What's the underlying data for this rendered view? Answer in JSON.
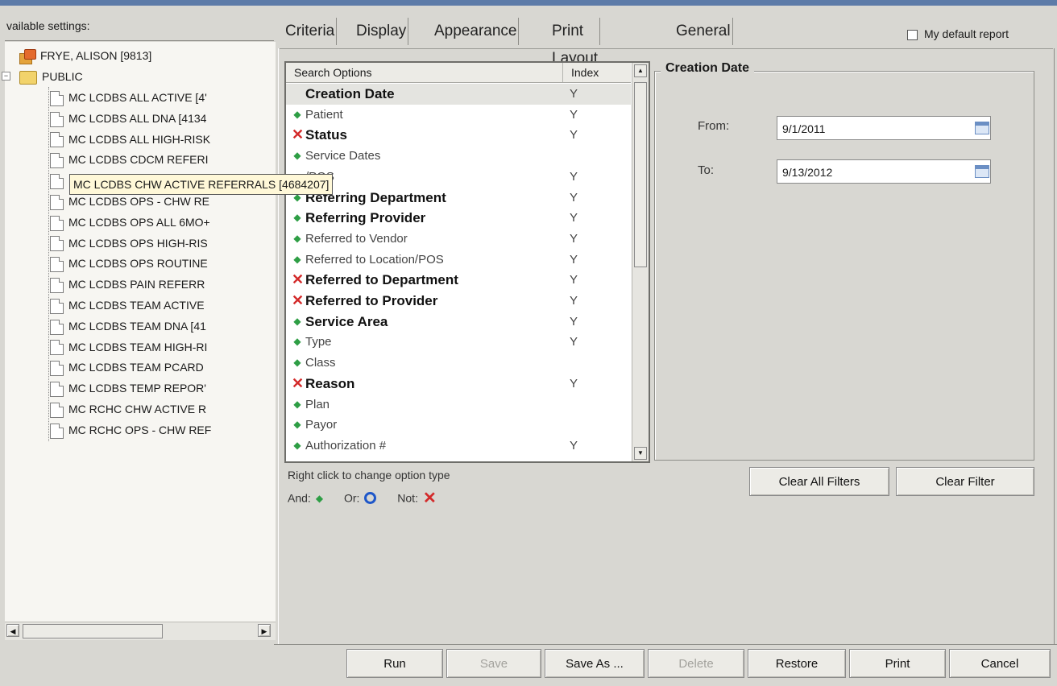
{
  "left_panel": {
    "available_label": "vailable settings:",
    "tree": {
      "user_node": "FRYE, ALISON [9813]",
      "public_node": "PUBLIC",
      "items": [
        "MC LCDBS ALL ACTIVE [4'",
        "MC LCDBS ALL DNA [4134",
        "MC LCDBS ALL HIGH-RISK",
        "MC LCDBS CDCM REFERI",
        "MC LCDBS CHW ACTIVE REFERRALS [4684207]",
        "MC LCDBS OPS - CHW RE",
        "MC LCDBS OPS ALL 6MO+",
        "MC LCDBS OPS HIGH-RIS",
        "MC LCDBS OPS ROUTINE",
        "MC LCDBS PAIN REFERR",
        "MC LCDBS TEAM ACTIVE",
        "MC LCDBS TEAM DNA [41",
        "MC LCDBS TEAM HIGH-RI",
        "MC LCDBS TEAM PCARD",
        "MC LCDBS TEMP REPOR'",
        "MC RCHC CHW ACTIVE R",
        "MC RCHC OPS - CHW REF"
      ],
      "tooltip": "MC LCDBS CHW ACTIVE REFERRALS [4684207]"
    }
  },
  "tabs": [
    "Criteria",
    "Display",
    "Appearance",
    "Print Layout",
    "General"
  ],
  "active_tab": "Criteria",
  "default_report": {
    "label": "My default report",
    "checked": false
  },
  "search_options": {
    "header_name": "Search Options",
    "header_index": "Index",
    "rows": [
      {
        "label": "Creation Date",
        "type": "none",
        "index": "Y",
        "bold": true,
        "selected": true
      },
      {
        "label": "Patient",
        "type": "and",
        "index": "Y",
        "bold": false
      },
      {
        "label": "Status",
        "type": "not",
        "index": "Y",
        "bold": true
      },
      {
        "label": "Service Dates",
        "type": "and",
        "index": "",
        "bold": false
      },
      {
        "label": "/POS",
        "type": "none",
        "index": "Y",
        "bold": false
      },
      {
        "label": "Referring Department",
        "type": "and",
        "index": "Y",
        "bold": true
      },
      {
        "label": "Referring Provider",
        "type": "and",
        "index": "Y",
        "bold": true
      },
      {
        "label": "Referred to Vendor",
        "type": "and",
        "index": "Y",
        "bold": false
      },
      {
        "label": "Referred to Location/POS",
        "type": "and",
        "index": "Y",
        "bold": false
      },
      {
        "label": "Referred to Department",
        "type": "not",
        "index": "Y",
        "bold": true
      },
      {
        "label": "Referred to Provider",
        "type": "not",
        "index": "Y",
        "bold": true
      },
      {
        "label": "Service Area",
        "type": "and",
        "index": "Y",
        "bold": true
      },
      {
        "label": "Type",
        "type": "and",
        "index": "Y",
        "bold": false
      },
      {
        "label": "Class",
        "type": "and",
        "index": "",
        "bold": false
      },
      {
        "label": "Reason",
        "type": "not",
        "index": "Y",
        "bold": true
      },
      {
        "label": "Plan",
        "type": "and",
        "index": "",
        "bold": false
      },
      {
        "label": "Payor",
        "type": "and",
        "index": "",
        "bold": false
      },
      {
        "label": "Authorization #",
        "type": "and",
        "index": "Y",
        "bold": false
      }
    ]
  },
  "legend": {
    "hint": "Right click to change option type",
    "and": "And:",
    "or": "Or:",
    "not": "Not:"
  },
  "creation_date": {
    "title": "Creation Date",
    "from_label": "From:",
    "from_value": "9/1/2011",
    "to_label": "To:",
    "to_value": "9/13/2012"
  },
  "filter_buttons": {
    "clear_all": "Clear All Filters",
    "clear": "Clear Filter"
  },
  "bottom_buttons": {
    "run": "Run",
    "save": "Save",
    "save_as": "Save As ...",
    "delete": "Delete",
    "restore": "Restore",
    "print": "Print",
    "cancel": "Cancel"
  },
  "colors": {
    "and": "#2e9e45",
    "or": "#1f57c9",
    "not": "#d32a2a"
  }
}
